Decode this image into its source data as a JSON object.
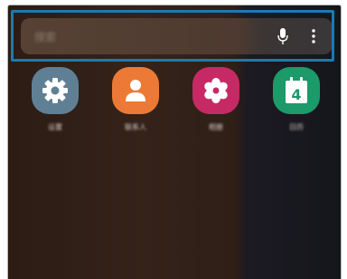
{
  "search": {
    "placeholder_text": "搜索",
    "mic_icon": "mic-icon",
    "more_icon": "more-options-icon"
  },
  "apps": [
    {
      "label": "设置",
      "icon": "gear-icon",
      "color": "#5f7f94"
    },
    {
      "label": "联系人",
      "icon": "person-icon",
      "color": "#ec7a36"
    },
    {
      "label": "相册",
      "icon": "flower-icon",
      "color": "#c62a64"
    },
    {
      "label": "日历",
      "icon": "calendar-icon",
      "color": "#1c9a69",
      "badge": "4"
    }
  ],
  "colors": {
    "highlight": "#1a7ab4"
  }
}
